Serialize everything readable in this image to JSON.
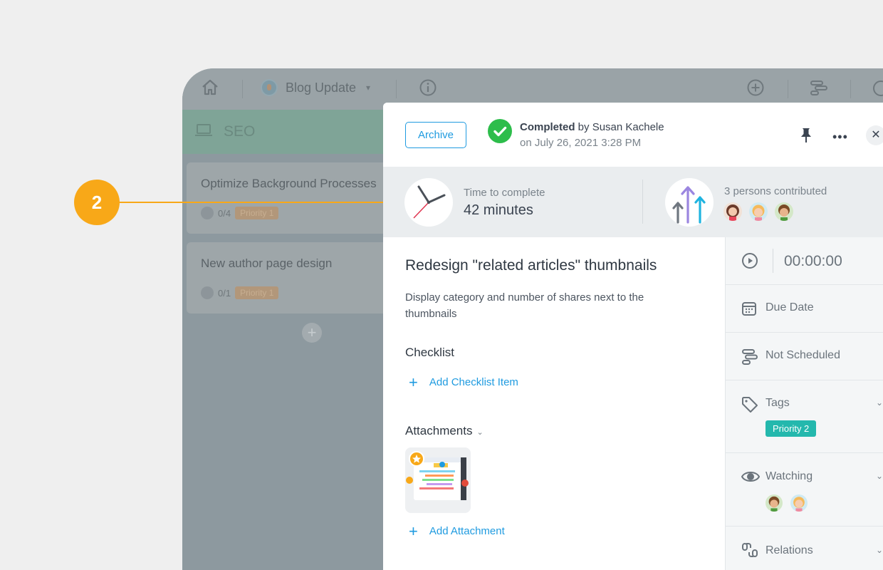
{
  "background_app": {
    "project_name": "Blog Update",
    "column_title": "SEO",
    "cards": [
      {
        "title": "Optimize Background Processes",
        "subtasks": "0/4",
        "priority": "Priority 1"
      },
      {
        "title": "New author page design",
        "subtasks": "0/1",
        "priority": "Priority 1"
      }
    ],
    "add_card_symbol": "+"
  },
  "callout": {
    "number": "2",
    "color": "#f8a818"
  },
  "panel": {
    "archive_label": "Archive",
    "status_bold": "Completed",
    "status_by": " by Susan Kachele",
    "status_date": "on July 26, 2021 3:28 PM",
    "more_symbol": "•••",
    "close_symbol": "✕",
    "time_label": "Time to complete",
    "time_value": "42 minutes",
    "contrib_label": "3 persons contributed",
    "task_title": "Redesign \"related articles\" thumbnails",
    "task_description": "Display category and number of shares next to the thumbnails",
    "checklist_title": "Checklist",
    "add_checklist_label": "Add Checklist Item",
    "attachments_title": "Attachments",
    "add_attachment_label": "Add Attachment",
    "plus_symbol": "+"
  },
  "sidebar": {
    "timer": "00:00:00",
    "due_date": "Due Date",
    "not_scheduled": "Not Scheduled",
    "tags": "Tags",
    "tag_chip": "Priority 2",
    "watching": "Watching",
    "relations": "Relations"
  },
  "colors": {
    "accent": "#1f9be0",
    "success": "#2dbd4b",
    "tag": "#24b8ad"
  }
}
